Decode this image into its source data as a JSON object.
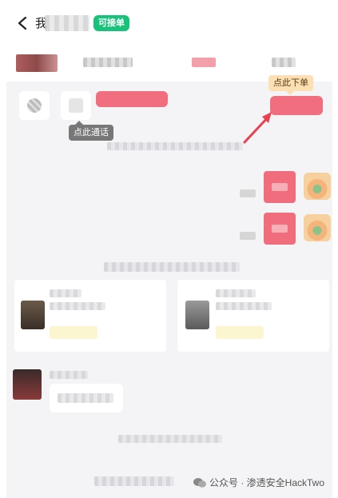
{
  "header": {
    "title": "我",
    "badge": "可接单"
  },
  "tooltips": {
    "call_hint": "点此通话",
    "order_hint": "点此下单"
  },
  "watermark": {
    "label": "公众号 · 渗透安全HackTwo"
  },
  "colors": {
    "accent_green": "#19c27a",
    "accent_red": "#f0566a",
    "tooltip_orange": "#fce0b4",
    "arrow_red": "#e8404f"
  },
  "icons": {
    "back": "chevron-left-icon",
    "wechat": "wechat-icon"
  }
}
